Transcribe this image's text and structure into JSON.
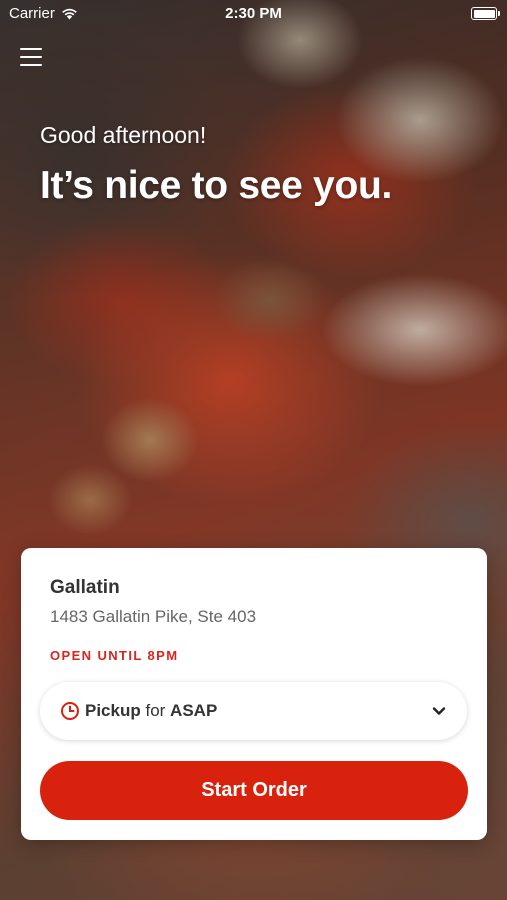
{
  "status_bar": {
    "carrier": "Carrier",
    "time": "2:30 PM",
    "wifi_icon": "wifi-icon",
    "battery_icon": "battery-icon"
  },
  "header": {
    "menu_icon": "hamburger-menu-icon",
    "greeting": "Good afternoon!",
    "headline": "It’s nice to see you."
  },
  "store_card": {
    "name": "Gallatin",
    "address": "1483 Gallatin Pike, Ste 403",
    "hours": "OPEN UNTIL 8PM",
    "order_mode": {
      "icon": "clock-icon",
      "mode": "Pickup",
      "connector": " for ",
      "time": "ASAP",
      "chevron_icon": "chevron-down-icon"
    },
    "start_button": "Start Order"
  },
  "colors": {
    "accent": "#d9220e",
    "hours_text": "#d9261c",
    "card_bg": "#ffffff"
  }
}
